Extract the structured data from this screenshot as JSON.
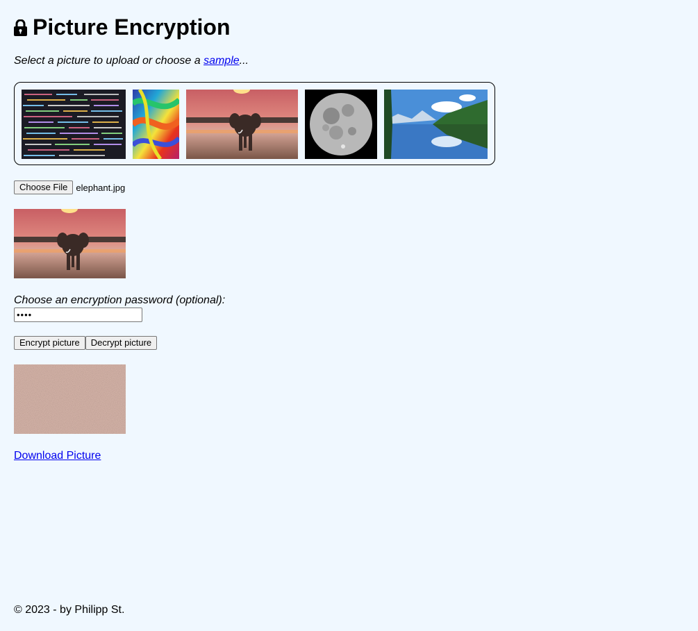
{
  "header": {
    "title": "Picture Encryption",
    "icon": "lock-icon"
  },
  "intro": {
    "before": "Select a picture to upload or choose a ",
    "link": "sample",
    "after": "..."
  },
  "samples": [
    {
      "name": "sample-code",
      "icon": "code-thumbnail"
    },
    {
      "name": "sample-colorful",
      "icon": "paint-swirl-thumbnail"
    },
    {
      "name": "sample-elephant",
      "icon": "elephant-thumbnail"
    },
    {
      "name": "sample-moon",
      "icon": "moon-thumbnail"
    },
    {
      "name": "sample-lake",
      "icon": "lake-thumbnail"
    }
  ],
  "file_input": {
    "button_label": "Choose File",
    "file_name": "elephant.jpg"
  },
  "password": {
    "label": "Choose an encryption password (optional):",
    "value": "••••"
  },
  "actions": {
    "encrypt_label": "Encrypt picture",
    "decrypt_label": "Decrypt picture"
  },
  "download_label": "Download Picture",
  "footer": "© 2023 - by Philipp St.",
  "colors": {
    "background": "#f0f8ff",
    "link": "#0000ee",
    "encrypted_noise": "#8a5e52"
  }
}
